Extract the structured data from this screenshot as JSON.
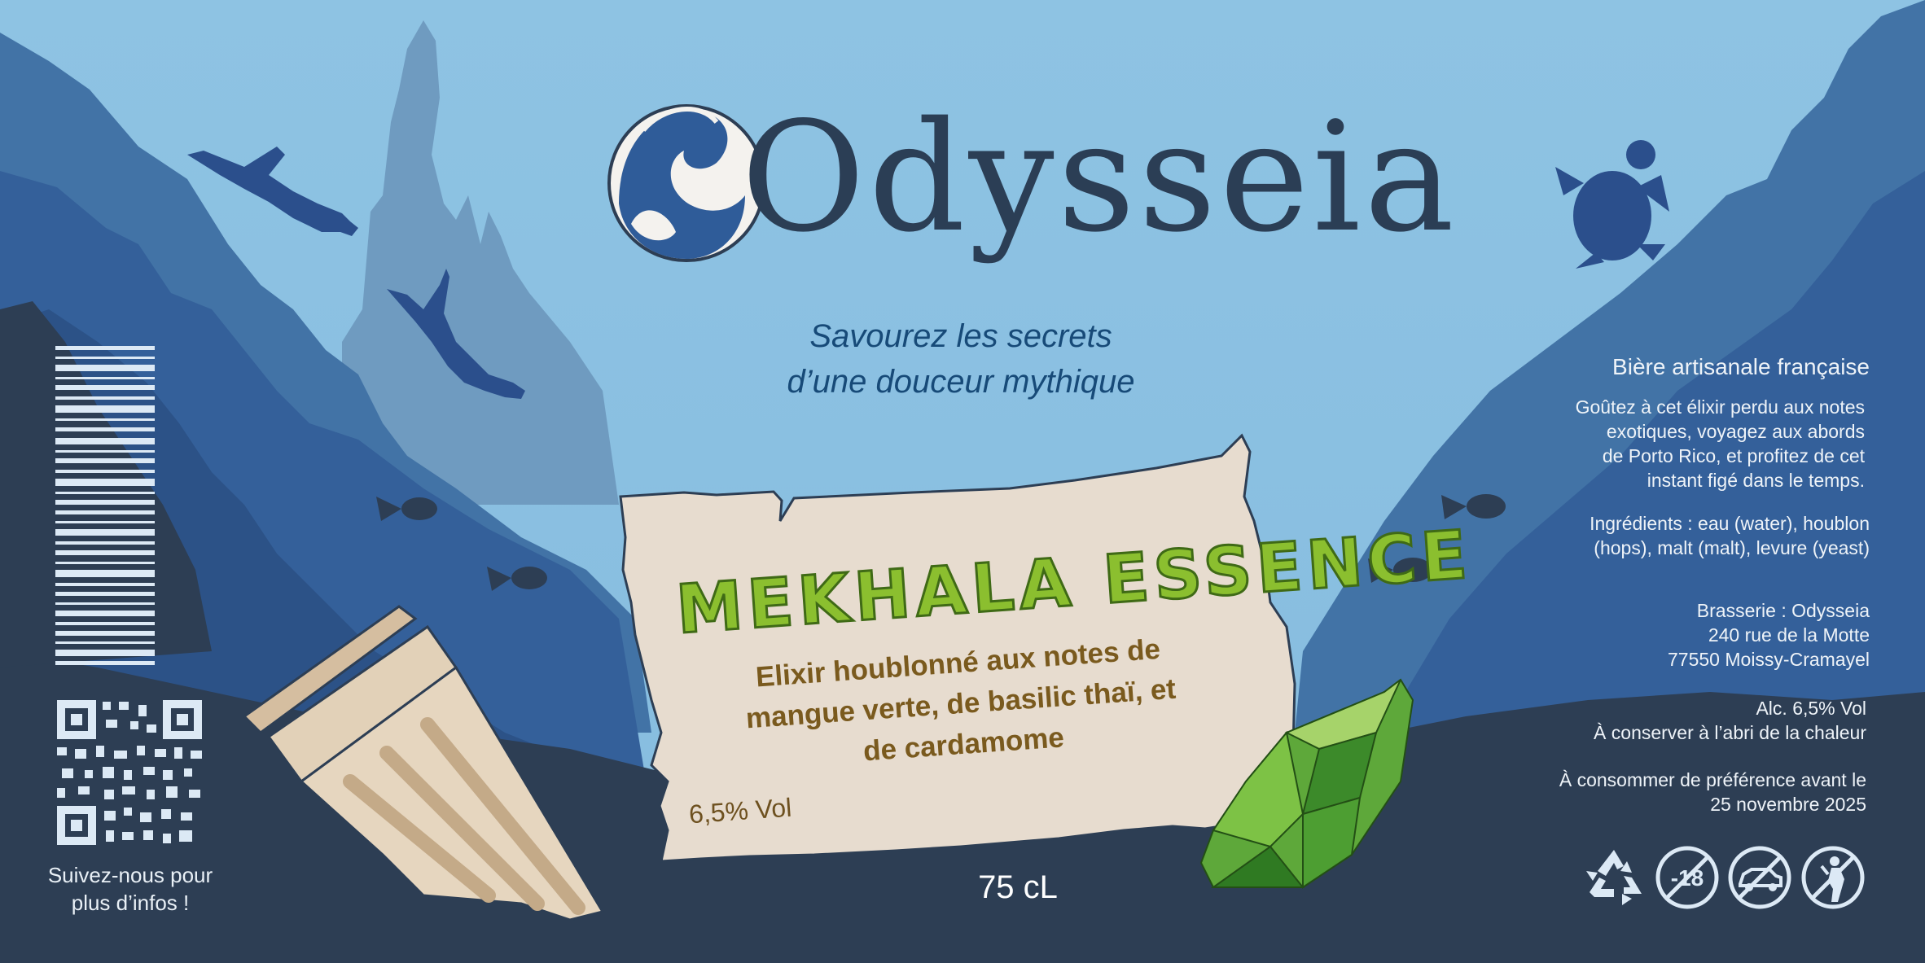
{
  "brand": {
    "name": "Odysseia"
  },
  "tagline": {
    "line1": "Savourez les secrets",
    "line2": "d’une douceur mythique"
  },
  "product": {
    "name": "MEKHALA ESSENCE",
    "description_lines": [
      "Elixir houblonné aux notes de",
      "mangue verte, de basilic thaï, et",
      "de cardamome"
    ],
    "abv": "6,5% Vol",
    "volume": "75 cL"
  },
  "social": {
    "line1": "Suivez-nous pour",
    "line2": "plus d’infos !"
  },
  "info": {
    "heading": "Bière artisanale française",
    "description_lines": [
      "Goûtez à cet élixir perdu aux notes",
      "exotiques, voyagez aux abords",
      "de Porto Rico, et profitez de cet",
      "instant figé dans le temps."
    ],
    "ingredients_lines": [
      "Ingrédients : eau (water), houblon",
      "(hops), malt (malt), levure (yeast)"
    ],
    "brewery_lines": [
      "Brasserie : Odysseia",
      "240 rue de la Motte",
      "77550 Moissy-Cramayel"
    ],
    "alcohol_lines": [
      "Alc. 6,5% Vol",
      "À conserver à l’abri de la chaleur"
    ],
    "bestbefore_lines": [
      "À consommer de préférence avant le",
      "25 novembre 2025"
    ]
  },
  "icons": {
    "age_badge": "-18",
    "list": [
      "recycle-icon",
      "no-minors-icon",
      "no-driving-icon",
      "no-pregnant-icon"
    ]
  },
  "colors": {
    "sky": "#8cc0e0",
    "deep_navy": "#2d3e54",
    "parchment": "#e7dccf",
    "product_green": "#8bbf2f",
    "tagline_blue": "#174a78",
    "brown_text": "#7a5a1e"
  }
}
